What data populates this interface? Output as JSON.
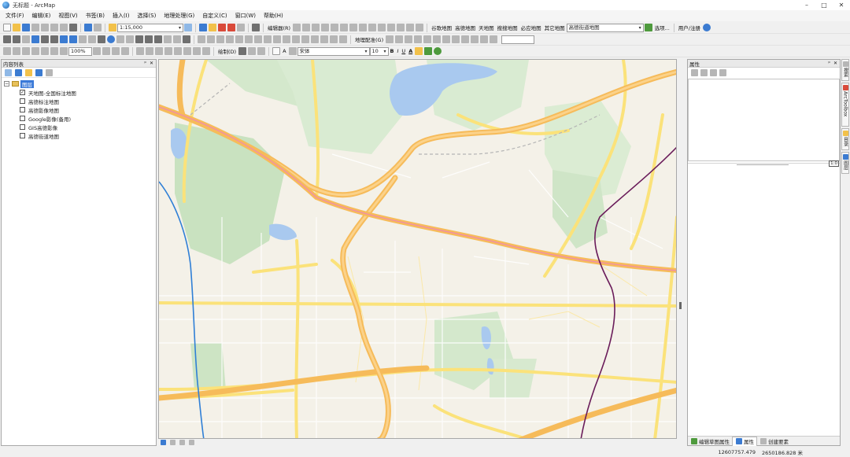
{
  "window": {
    "title": "无标题 - ArcMap",
    "minimize": "–",
    "maximize": "□",
    "close": "✕"
  },
  "menu": [
    "文件(F)",
    "编辑(E)",
    "视图(V)",
    "书签(B)",
    "插入(I)",
    "选择(S)",
    "地理处理(G)",
    "自定义(C)",
    "窗口(W)",
    "帮助(H)"
  ],
  "toolbar": {
    "scale_value": "1:15,000",
    "editor_label": "编辑器(R)",
    "plugins": [
      "谷歌地图",
      "高德地图",
      "天地图",
      "搜搜地图",
      "必应地图",
      "其它地图"
    ],
    "map_source_value": "高德街道地图",
    "options_label": "选项...",
    "user_label": "用户/注册",
    "georef_label": "地理配准(G)",
    "zoom_value": "100%",
    "draw_label": "绘制(D)",
    "font_value": "宋体",
    "font_size_value": "10",
    "bold": "B",
    "italic": "I",
    "underline": "U",
    "text_tool": "A",
    "draw_text_tool": "A"
  },
  "toc": {
    "title": "内容列表",
    "root_label": "图层",
    "layers": [
      {
        "label": "天地图-全国标注地图",
        "checked": true
      },
      {
        "label": "高德标注地图",
        "checked": false
      },
      {
        "label": "高德影像地图",
        "checked": false
      },
      {
        "label": "Google影像(备用)",
        "checked": false
      },
      {
        "label": "GIS高德影像",
        "checked": false
      },
      {
        "label": "高德街道地图",
        "checked": false
      }
    ]
  },
  "properties": {
    "title": "属性",
    "scale_chip": "1:0",
    "bottom_tabs": [
      "编辑草图属性",
      "属性",
      "创建要素"
    ]
  },
  "dock_tabs": [
    "搜索",
    "ArcToolbox",
    "目录",
    "图层"
  ],
  "status": {
    "x": "12607757.479",
    "y": "2650186.828 米"
  },
  "colors": {
    "map_background": "#f4f1e8",
    "major_road": "#f6bb5a",
    "secondary_road": "#fbe27a",
    "water": "#a9c9ef",
    "green": "#c9e2c0",
    "rail_pink": "#f08ab0",
    "river_blue": "#2f7fd6",
    "metro_purple": "#6a1c5a"
  }
}
